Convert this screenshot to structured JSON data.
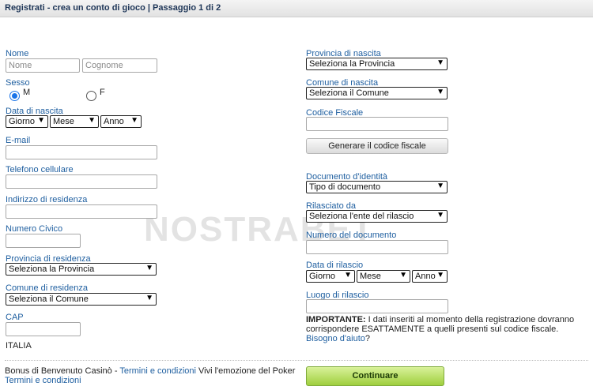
{
  "header": {
    "title": "Registrati - crea un conto di gioco | Passaggio 1 di 2"
  },
  "left": {
    "nome_label": "Nome",
    "nome_placeholder": "Nome",
    "cognome_placeholder": "Cognome",
    "sesso_label": "Sesso",
    "sesso_m": "M",
    "sesso_f": "F",
    "sesso_selected": "M",
    "nascita_label": "Data di nascita",
    "giorno": "Giorno",
    "mese": "Mese",
    "anno": "Anno",
    "email_label": "E-mail",
    "telefono_label": "Telefono cellulare",
    "indirizzo_label": "Indirizzo di residenza",
    "civico_label": "Numero Civico",
    "provincia_res_label": "Provincia di residenza",
    "provincia_res_value": "Seleziona la Provincia",
    "comune_res_label": "Comune di residenza",
    "comune_res_value": "Seleziona il Comune",
    "cap_label": "CAP",
    "country": "ITALIA"
  },
  "right": {
    "provincia_nascita_label": "Provincia di nascita",
    "provincia_nascita_value": "Seleziona la Provincia",
    "comune_nascita_label": "Comune di nascita",
    "comune_nascita_value": "Seleziona il Comune",
    "codice_fiscale_label": "Codice Fiscale",
    "genera_button": "Generare il codice fiscale",
    "documento_label": "Documento d'identità",
    "documento_value": "Tipo di documento",
    "rilasciato_label": "Rilasciato da",
    "rilasciato_value": "Seleziona l'ente del rilascio",
    "numero_doc_label": "Numero del documento",
    "data_rilascio_label": "Data di rilascio",
    "giorno": "Giorno",
    "mese": "Mese",
    "anno": "Anno",
    "luogo_label": "Luogo di rilascio",
    "note_bold": "IMPORTANTE:",
    "note_text": " I dati inseriti al momento della registrazione dovranno corrispondere ESATTAMENTE a quelli presenti sul codice fiscale. ",
    "note_link": "Bisogno d'aiuto",
    "note_end": "?"
  },
  "footer": {
    "bonus_text": "Bonus di Benvenuto Casinò - ",
    "terms_link_1": "Termini e condizioni",
    "poker_text": " Vivi l'emozione del Poker",
    "terms_link_2": "Termini e condizioni",
    "continue_button": "Continuare"
  },
  "watermark": "NOSTRABET"
}
